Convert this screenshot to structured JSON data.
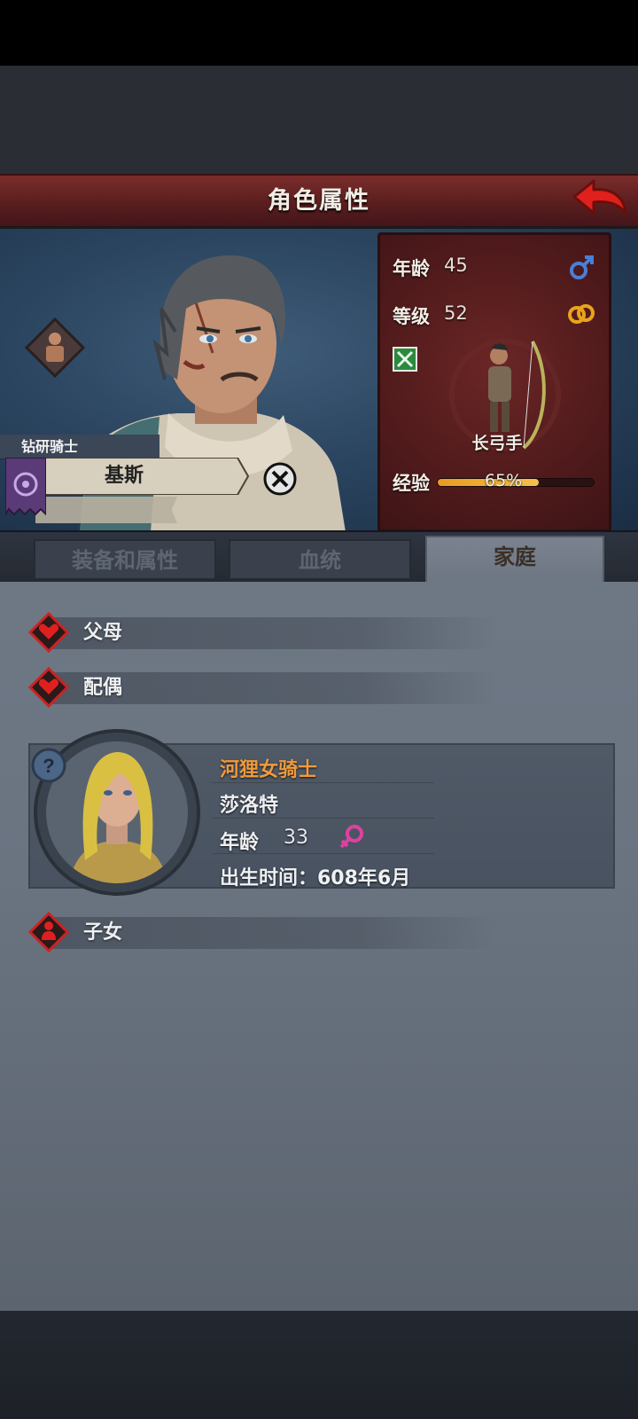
{
  "header": {
    "title": "角色属性"
  },
  "hero": {
    "title_plate": "钻研骑士",
    "name": "基斯"
  },
  "stats": {
    "age_label": "年龄",
    "age_value": "45",
    "level_label": "等级",
    "level_value": "52",
    "class_name": "长弓手",
    "exp_label": "经验",
    "exp_text": "65%",
    "exp_fraction": 0.65
  },
  "tabs": [
    {
      "label": "装备和属性",
      "active": false
    },
    {
      "label": "血统",
      "active": false
    },
    {
      "label": "家庭",
      "active": true
    }
  ],
  "family": {
    "parents_label": "父母",
    "spouse_label": "配偶",
    "children_label": "子女",
    "spouse": {
      "title": "河狸女骑士",
      "name": "莎洛特",
      "age_label": "年龄",
      "age_value": "33",
      "birth": "出生时间：608年6月"
    }
  },
  "colors": {
    "title_bar": "#6a2424",
    "stats_panel": "#5a1e1f",
    "accent_orange": "#f09a3e",
    "male_icon": "#4a7fd6",
    "female_icon": "#e040a0"
  }
}
